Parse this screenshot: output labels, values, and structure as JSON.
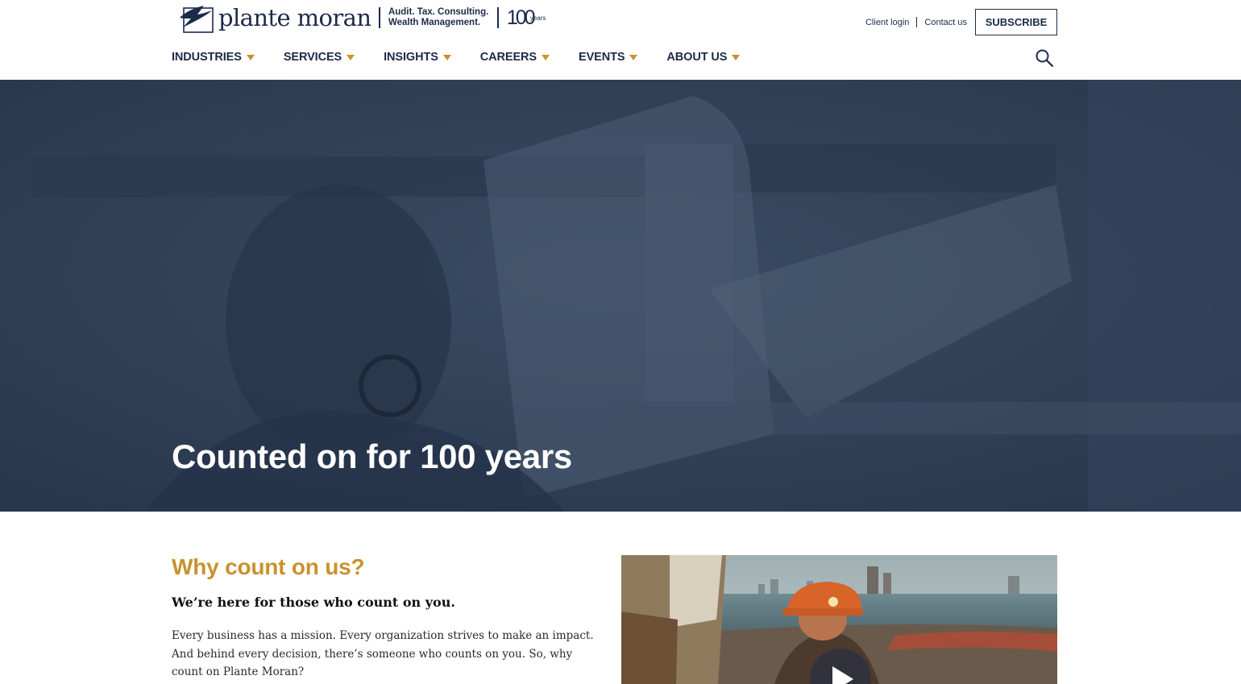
{
  "brand": {
    "name": "plante moran",
    "tagline_line1": "Audit. Tax. Consulting.",
    "tagline_line2": "Wealth Management.",
    "anniversary_number": "100",
    "anniversary_word": "years"
  },
  "utility": {
    "client_login": "Client login",
    "contact_us": "Contact us",
    "subscribe": "SUBSCRIBE"
  },
  "nav": {
    "items": [
      {
        "label": "INDUSTRIES"
      },
      {
        "label": "SERVICES"
      },
      {
        "label": "INSIGHTS"
      },
      {
        "label": "CAREERS"
      },
      {
        "label": "EVENTS"
      },
      {
        "label": "ABOUT US"
      }
    ]
  },
  "hero": {
    "title": "Counted on for 100 years"
  },
  "why": {
    "heading": "Why count on us?",
    "subheading": "We’re here for those who count on you.",
    "body": "Every business has a mission. Every organization strives to make an impact. And behind every decision, there’s someone who counts on you. So, why count on Plante Moran?"
  },
  "colors": {
    "navy": "#1c2b4a",
    "gold": "#c9922e",
    "hero_overlay": "#2f4057"
  },
  "icons": {
    "search": "search-icon",
    "caret": "caret-down-icon",
    "play": "play-icon"
  }
}
